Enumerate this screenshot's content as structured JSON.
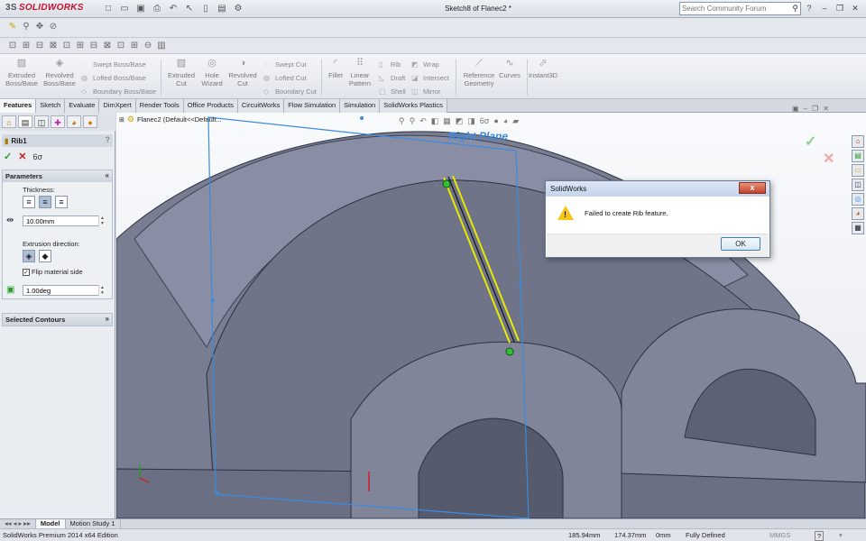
{
  "app": {
    "brand_prefix": "3S",
    "brand": "SOLIDWORKS",
    "doc_title": "Sketch8 of Flanec2 *"
  },
  "search": {
    "placeholder": "Search Community Forum"
  },
  "command_manager": {
    "extruded_boss": "Extruded\nBoss/Base",
    "revolved_boss": "Revolved\nBoss/Base",
    "swept_boss": "Swept Boss/Base",
    "lofted_boss": "Lofted Boss/Base",
    "boundary_boss": "Boundary Boss/Base",
    "extruded_cut": "Extruded\nCut",
    "hole_wizard": "Hole\nWizard",
    "revolved_cut": "Revolved\nCut",
    "swept_cut": "Swept Cut",
    "lofted_cut": "Lofted Cut",
    "boundary_cut": "Boundary Cut",
    "fillet": "Fillet",
    "linear_pattern": "Linear\nPattern",
    "rib": "Rib",
    "draft": "Draft",
    "shell": "Shell",
    "wrap": "Wrap",
    "intersect": "Intersect",
    "mirror": "Mirror",
    "reference_geometry": "Reference\nGeometry",
    "curves": "Curves",
    "instant3d": "Instant3D"
  },
  "tabs": [
    "Features",
    "Sketch",
    "Evaluate",
    "DimXpert",
    "Render Tools",
    "Office Products",
    "CircuitWorks",
    "Flow Simulation",
    "Simulation",
    "SolidWorks Plastics"
  ],
  "property_manager": {
    "title": "Rib1",
    "help": "?",
    "parameters_label": "Parameters",
    "thickness_label": "Thickness:",
    "thickness_value": "10.00mm",
    "extrusion_direction_label": "Extrusion direction:",
    "flip_material_label": "Flip material side",
    "flip_material_checked": true,
    "draft_value": "1.00deg",
    "selected_contours_label": "Selected Contours"
  },
  "graphics": {
    "tree_item": "Flanec2  (Default<<Default...",
    "plane_label": "Right Plane"
  },
  "dialog": {
    "title": "SolidWorks",
    "close": "x",
    "message": "Failed to create Rib feature.",
    "ok": "OK"
  },
  "bottom_tabs": [
    "Model",
    "Motion Study 1"
  ],
  "status": {
    "edition": "SolidWorks Premium 2014 x64 Edition",
    "x": "185.94mm",
    "y": "174.37mm",
    "z": "0mm",
    "state": "Fully Defined",
    "units": "MMGS",
    "help": "?"
  },
  "colors": {
    "accent": "#3a8be0",
    "warning": "#f5c518",
    "ok": "#2b9a2b",
    "cancel": "#c41e1e",
    "rib": "#e8e800",
    "model": "#7b7f94"
  }
}
